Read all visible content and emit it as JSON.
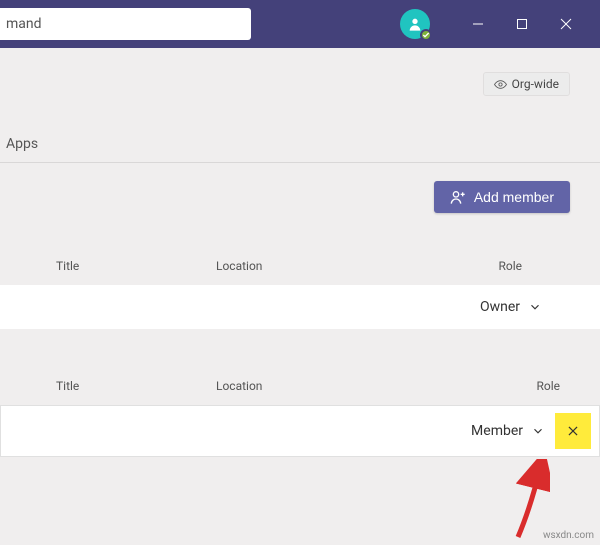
{
  "titlebar": {
    "search_placeholder": "mand"
  },
  "org_tag": "Org-wide",
  "tabs": {
    "apps": "Apps"
  },
  "add_button_label": "Add member",
  "columns": {
    "title": "Title",
    "location": "Location",
    "role": "Role"
  },
  "sections": [
    {
      "role_value": "Owner"
    },
    {
      "role_value": "Member"
    }
  ],
  "watermark": "wsxdn.com",
  "colors": {
    "accent": "#6264a7",
    "highlight": "#ffeb3b"
  }
}
